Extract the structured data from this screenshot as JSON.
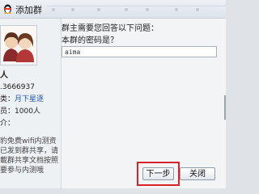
{
  "window": {
    "title": "添加群"
  },
  "group": {
    "name_fragment": "人",
    "id_fragment": ".3666937",
    "category_label": "类：",
    "category_value": "月下星逐",
    "members_label": "员：",
    "members_value": "1000人",
    "intro_label": "介：",
    "intro_lines": [
      "豹免费wifi内测资",
      "已发到群共享，请",
      "載群共享文档按照",
      "要参与内测哦"
    ]
  },
  "question": {
    "prompt": "群主需要您回答以下问题：",
    "text": "本群的密码是？",
    "answer_value": "aima"
  },
  "buttons": {
    "next": "下一步",
    "close": "关闭"
  },
  "colors": {
    "highlight": "#d8232a",
    "link_blue": "#1a55a8"
  }
}
